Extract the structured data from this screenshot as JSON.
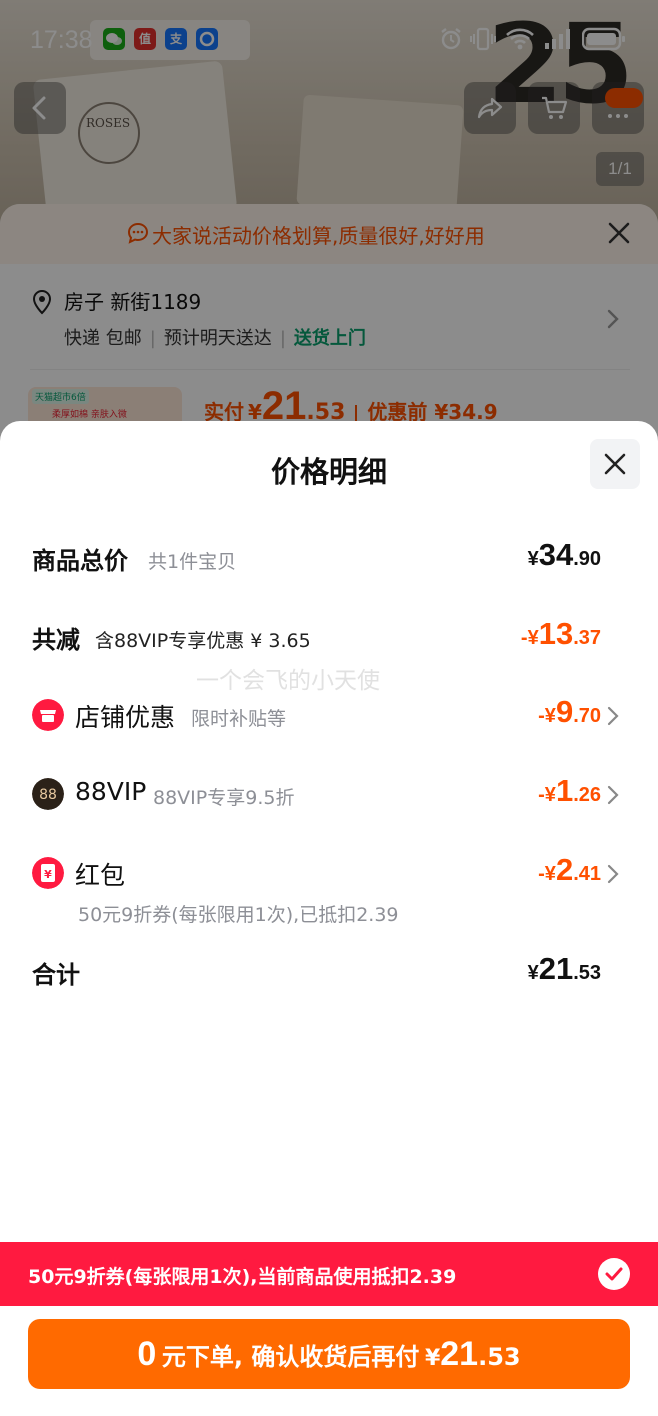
{
  "status_bar": {
    "time": "17:38",
    "apps": [
      "wechat-icon",
      "smzdm-icon",
      "alipay-icon",
      "browser-icon"
    ],
    "app_labels": {
      "smzdm": "值",
      "alipay": "支"
    },
    "icons": [
      "alarm-icon",
      "vibrate-icon",
      "wifi-icon",
      "signal-icon",
      "battery-icon"
    ]
  },
  "background": {
    "photo_count": "1/1",
    "product_text": "25",
    "roses_text": "ROSES",
    "tip": "大家说活动价格划算,质量很好,好好用",
    "address": {
      "name": "房子 新街1189",
      "shipping": "快递 包邮",
      "eta": "预计明天送达",
      "door": "送货上门"
    },
    "thumb": {
      "badge": "天猫超市6倍",
      "text": "柔厚如棉 亲肤入微"
    },
    "paid": {
      "label": "实付",
      "currency": "¥",
      "integer": "21",
      "decimal": ".53",
      "before_label": "优惠前 ¥34.9"
    }
  },
  "modal": {
    "title": "价格明细",
    "rows": {
      "total": {
        "label": "商品总价",
        "sub": "共1件宝贝",
        "currency": "¥",
        "integer": "34",
        "decimal": ".90"
      },
      "discount": {
        "label": "共减",
        "sub": "含88VIP专享优惠 ¥ 3.65",
        "currency": "-¥",
        "integer": "13",
        "decimal": ".37"
      },
      "shop": {
        "label": "店铺优惠",
        "sub": "限时补贴等",
        "currency": "-¥",
        "integer": "9",
        "decimal": ".70"
      },
      "vip": {
        "label": "88VIP",
        "sub": "88VIP专享9.5折",
        "icon_text": "88",
        "currency": "-¥",
        "integer": "1",
        "decimal": ".26"
      },
      "redpacket": {
        "label": "红包",
        "note": "50元9折券(每张限用1次),已抵扣2.39",
        "icon_text": "¥",
        "currency": "-¥",
        "integer": "2",
        "decimal": ".41"
      },
      "sum": {
        "label": "合计",
        "currency": "¥",
        "integer": "21",
        "decimal": ".53"
      }
    },
    "watermark": "一个会飞的小天使",
    "coupon": "50元9折券(每张限用1次),当前商品使用抵扣2.39",
    "pay_button": {
      "zero": "0",
      "text": "元下单, 确认收货后再付",
      "currency": "¥",
      "integer": "21",
      "decimal": ".53"
    }
  },
  "colors": {
    "accent": "#ff5000",
    "coupon_red": "#ff1a40",
    "button_orange": "#ff6a00",
    "green": "#0aa06e"
  }
}
